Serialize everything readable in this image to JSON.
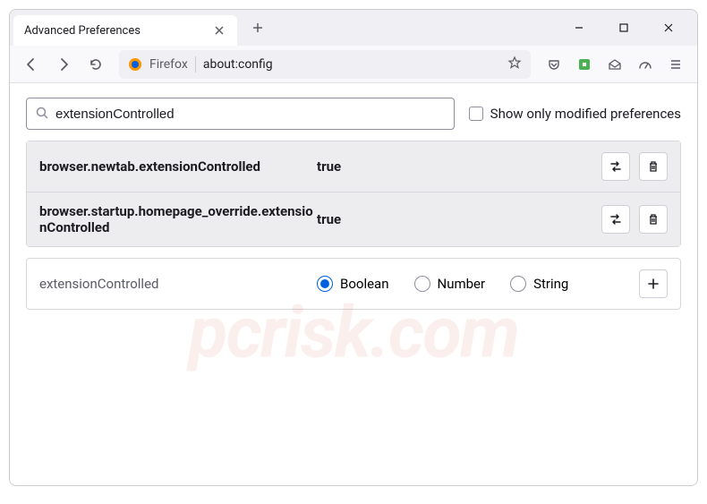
{
  "tab": {
    "title": "Advanced Preferences"
  },
  "address": {
    "brand": "Firefox",
    "url": "about:config"
  },
  "search": {
    "value": "extensionControlled",
    "modified_label": "Show only modified preferences"
  },
  "prefs": [
    {
      "name": "browser.newtab.extensionControlled",
      "value": "true"
    },
    {
      "name": "browser.startup.homepage_override.extensionControlled",
      "value": "true"
    }
  ],
  "new_pref": {
    "name": "extensionControlled",
    "types": {
      "boolean": "Boolean",
      "number": "Number",
      "string": "String"
    }
  },
  "watermark": "pcrisk.com"
}
